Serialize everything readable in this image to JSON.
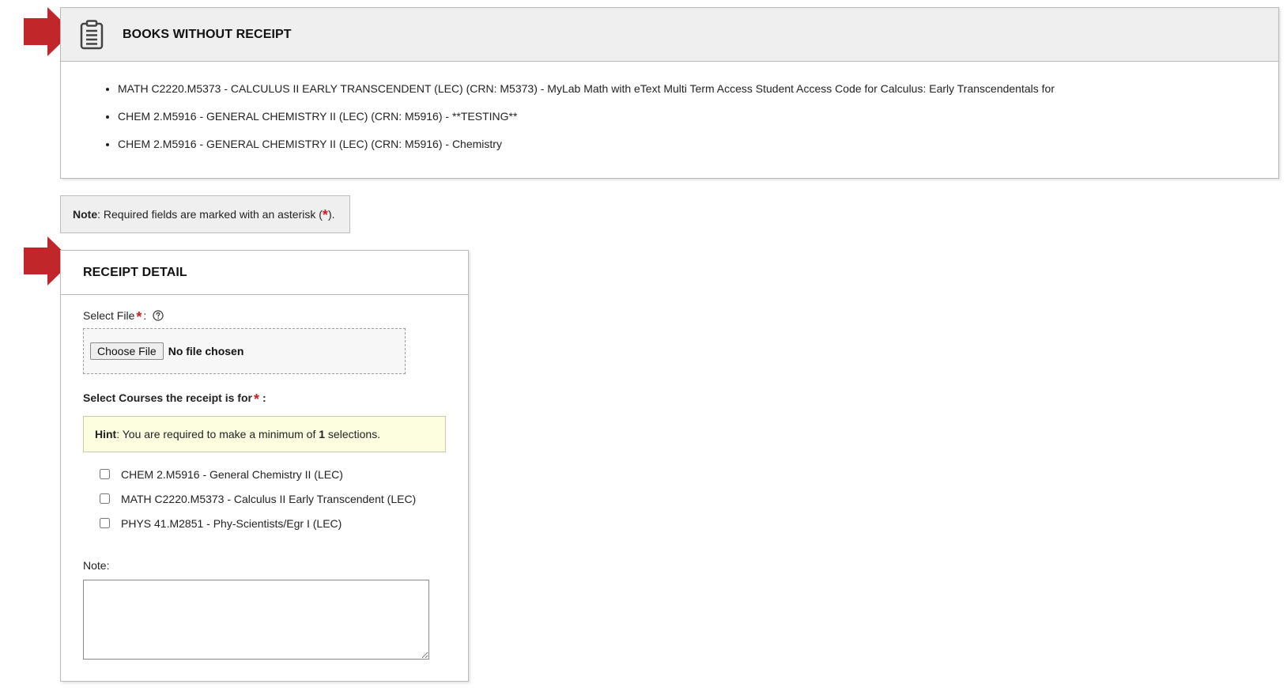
{
  "books_section": {
    "title": "BOOKS WITHOUT RECEIPT",
    "icon": "clipboard-icon",
    "items": [
      "MATH C2220.M5373 - CALCULUS II EARLY TRANSCENDENT (LEC) (CRN: M5373) - MyLab Math with eText Multi Term Access Student Access Code for Calculus: Early Transcendentals for",
      "CHEM 2.M5916 - GENERAL CHEMISTRY II (LEC) (CRN: M5916) - **TESTING**",
      "CHEM 2.M5916 - GENERAL CHEMISTRY II (LEC) (CRN: M5916) - Chemistry"
    ]
  },
  "note_banner": {
    "label": "Note",
    "text_before": ": Required fields are marked with an asterisk (",
    "star": "*",
    "text_after": ")."
  },
  "receipt_section": {
    "title": "RECEIPT DETAIL",
    "select_file": {
      "label": "Select File",
      "star": "*",
      "colon": ":",
      "help_icon": "question-circle-icon",
      "button_label": "Choose File",
      "status": "No file chosen"
    },
    "courses": {
      "label": "Select Courses the receipt is for",
      "star": "*",
      "colon": ":",
      "hint_label": "Hint",
      "hint_before": ": You are required to make a minimum of ",
      "hint_count": "1",
      "hint_after": " selections.",
      "options": [
        {
          "label": "CHEM 2.M5916 - General Chemistry II (LEC)",
          "checked": false
        },
        {
          "label": "MATH C2220.M5373 - Calculus II Early Transcendent (LEC)",
          "checked": false
        },
        {
          "label": "PHYS 41.M2851 - Phy-Scientists/Egr I (LEC)",
          "checked": false
        }
      ]
    },
    "note": {
      "label": "Note:",
      "value": ""
    }
  },
  "colors": {
    "arrow": "#c0262a",
    "required": "#cc1f1f",
    "header_bg": "#efefef",
    "hint_bg": "#fdfde0"
  }
}
